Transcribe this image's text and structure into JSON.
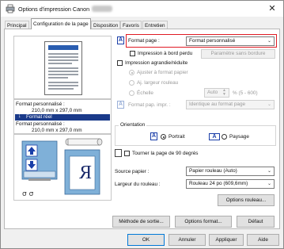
{
  "window": {
    "title": "Options d'impression Canon",
    "close_glyph": "✕",
    "tabs": [
      {
        "label": "Principal"
      },
      {
        "label": "Configuration de la page"
      },
      {
        "label": "Disposition"
      },
      {
        "label": "Favoris"
      },
      {
        "label": "Entretien"
      }
    ]
  },
  "preview": {
    "format_personnalise_1": "Format personnalisé :",
    "size_1": "210,0 mm x 297,0 mm",
    "arrow_label": "Format réel",
    "format_personnalise_2": "Format personnalisé :",
    "size_2": "210,0 mm x 297,0 mm",
    "mirror_letter": "R"
  },
  "page_format": {
    "label": "Format page :",
    "value": "Format personnalisé",
    "borderless_label": "Impression à bord perdu",
    "borderless_checked": false,
    "borderless_settings_button": "Paramètre sans bordure"
  },
  "scaling": {
    "enlarge_label": "Impression agrandie/réduite",
    "enlarge_checked": false,
    "fit_paper_label": "Ajuster à format papier",
    "fit_roll_label": "Aj. largeur rouleau",
    "scale_label": "Échelle",
    "scale_value": "Auto",
    "scale_range": "% (5 - 600)",
    "printer_format_label": "Format pap. impr. :",
    "printer_format_value": "Identique au format page"
  },
  "orientation": {
    "group_label": "Orientation",
    "portrait_label": "Portrait",
    "paysage_label": "Paysage",
    "selected": "portrait",
    "rotate_label": "Tourner la page de 90 degrés",
    "rotate_checked": false
  },
  "paper": {
    "source_label": "Source papier :",
    "source_value": "Papier rouleau (Auto)",
    "roll_width_label": "Largeur du rouleau :",
    "roll_width_value": "Rouleau 24 po (609,6mm)",
    "roll_options_button": "Options rouleau..."
  },
  "bottom_buttons": {
    "output_method": "Méthode de sortie...",
    "format_options": "Options format...",
    "default": "Défaut"
  },
  "dialog_buttons": {
    "ok": "OK",
    "cancel": "Annuler",
    "apply": "Appliquer",
    "help": "Aide"
  },
  "colors": {
    "highlight_border": "#e01b24",
    "arrow_banner": "#1a3a8a",
    "selected_tab_bg": "#ffffff"
  }
}
